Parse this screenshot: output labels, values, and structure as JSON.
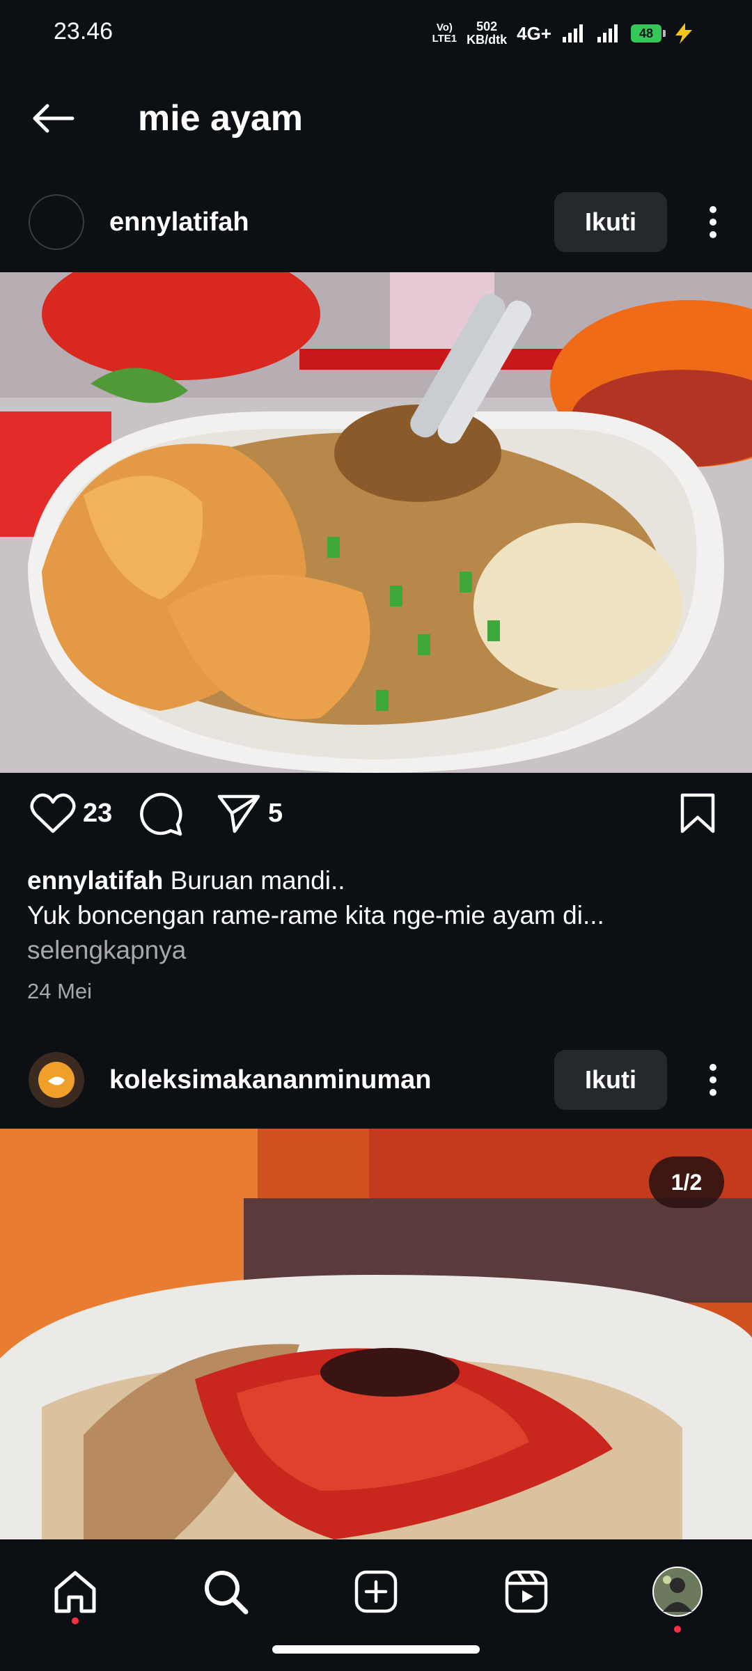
{
  "status_bar": {
    "time": "23.46",
    "volte": "Vo)",
    "volte_sub": "LTE1",
    "speed_value": "502",
    "speed_unit": "KB/dtk",
    "network": "4G+",
    "battery": "48"
  },
  "header": {
    "back_icon": "arrow-left-icon",
    "title": "mie ayam"
  },
  "posts": [
    {
      "username": "ennylatifah",
      "follow_label": "Ikuti",
      "likes": "23",
      "shares": "5",
      "caption_user": "ennylatifah",
      "caption_line1": "Buruan mandi..",
      "caption_line2": "Yuk boncengan rame-rame kita nge-mie ayam di...",
      "more_label": "selengkapnya",
      "date": "24 Mei"
    },
    {
      "username": "koleksimakananminuman",
      "follow_label": "Ikuti",
      "image_counter": "1/2"
    }
  ],
  "bottom_nav": {
    "items": [
      "home-icon",
      "search-icon",
      "create-icon",
      "reels-icon",
      "profile-avatar"
    ]
  },
  "colors": {
    "background": "#0c1014",
    "button": "#25292e",
    "muted_text": "#a8a8a8",
    "notification_dot": "#ff3040",
    "battery": "#34c759"
  }
}
